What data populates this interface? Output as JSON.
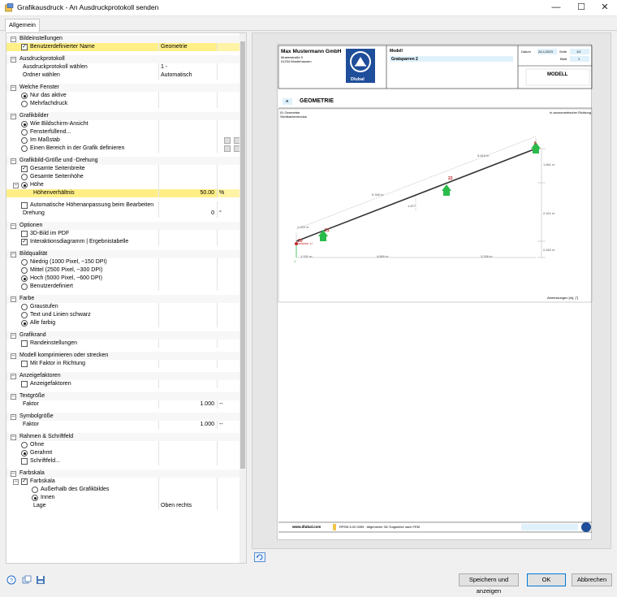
{
  "window": {
    "title": "Grafikausdruck - An Ausdruckprotokoll senden",
    "minimize": "—",
    "maximize": "☐",
    "close": "✕"
  },
  "tabs": [
    "Allgemein"
  ],
  "colors": {
    "selection": "#ffef86",
    "dlubal_blue": "#1f4e9a",
    "accent_blue": "#0078d7",
    "support_green": "#2bbb4a",
    "node_red": "#c0282d"
  },
  "rows": [
    {
      "kind": "hdr",
      "label": "Bildeinstellungen",
      "expanded": true
    },
    {
      "kind": "chk",
      "level": 1,
      "label": "Benutzerdefinierter Name",
      "checked": true,
      "value": "Geometrie",
      "selected": true
    },
    {
      "kind": "gap"
    },
    {
      "kind": "hdr",
      "label": "Ausdruckprotokoll",
      "expanded": true
    },
    {
      "kind": "txt",
      "level": 1,
      "label": "Ausdruckprotokoll wählen",
      "value": "1 -"
    },
    {
      "kind": "txt",
      "level": 1,
      "label": "Ordner wählen",
      "value": "Automatisch"
    },
    {
      "kind": "gap"
    },
    {
      "kind": "hdr",
      "label": "Welche Fenster",
      "expanded": true
    },
    {
      "kind": "rad",
      "level": 1,
      "label": "Nur das aktive",
      "checked": true
    },
    {
      "kind": "rad",
      "level": 1,
      "label": "Mehrfachdruck",
      "checked": false
    },
    {
      "kind": "gap"
    },
    {
      "kind": "hdr",
      "label": "Grafikbilder",
      "expanded": true
    },
    {
      "kind": "rad",
      "level": 1,
      "label": "Wie Bildschirm-Ansicht",
      "checked": true
    },
    {
      "kind": "rad",
      "level": 1,
      "label": "Fensterfüllend...",
      "checked": false
    },
    {
      "kind": "rad",
      "level": 1,
      "label": "Im Maßstab",
      "checked": false,
      "icons": true
    },
    {
      "kind": "rad",
      "level": 1,
      "label": "Einen Bereich in der Grafik definieren",
      "checked": false,
      "icons": true
    },
    {
      "kind": "gap"
    },
    {
      "kind": "hdr",
      "label": "Grafikbild-Größe und -Drehung",
      "expanded": true
    },
    {
      "kind": "chk",
      "level": 1,
      "label": "Gesamte Seitenbreite",
      "checked": true
    },
    {
      "kind": "rad",
      "level": 1,
      "label": "Gesamte Seitenhöhe",
      "checked": false
    },
    {
      "kind": "rad",
      "level": 1,
      "label": "Höhe",
      "checked": true,
      "expander": true
    },
    {
      "kind": "txt",
      "level": 2,
      "label": "Höhenverhältnis",
      "value": "50.00",
      "unit": "%",
      "selected": true,
      "numeric": true
    },
    {
      "kind": "gap"
    },
    {
      "kind": "chk",
      "level": 1,
      "label": "Automatische Höhenanpassung beim Bearbeiten",
      "checked": false
    },
    {
      "kind": "txt",
      "level": 1,
      "label": "Drehung",
      "value": "0",
      "unit": "°",
      "numeric": true
    },
    {
      "kind": "gap"
    },
    {
      "kind": "hdr",
      "label": "Optionen",
      "expanded": true
    },
    {
      "kind": "chk",
      "level": 1,
      "label": "3D-Bild im PDF",
      "checked": false
    },
    {
      "kind": "chk",
      "level": 1,
      "label": "Interaktionsdiagramm | Ergebnistabelle",
      "checked": true
    },
    {
      "kind": "gap"
    },
    {
      "kind": "hdr",
      "label": "Bildqualität",
      "expanded": true
    },
    {
      "kind": "rad",
      "level": 1,
      "label": "Niedrig (1000 Pixel, ~150 DPI)",
      "checked": false
    },
    {
      "kind": "rad",
      "level": 1,
      "label": "Mittel (2500 Pixel, ~300 DPI)",
      "checked": false
    },
    {
      "kind": "rad",
      "level": 1,
      "label": "Hoch (5000 Pixel, ~600 DPI)",
      "checked": true
    },
    {
      "kind": "rad",
      "level": 1,
      "label": "Benutzerdefiniert",
      "checked": false
    },
    {
      "kind": "gap"
    },
    {
      "kind": "hdr",
      "label": "Farbe",
      "expanded": true
    },
    {
      "kind": "rad",
      "level": 1,
      "label": "Graustufen",
      "checked": false
    },
    {
      "kind": "rad",
      "level": 1,
      "label": "Text und Linien schwarz",
      "checked": false
    },
    {
      "kind": "rad",
      "level": 1,
      "label": "Alle farbig",
      "checked": true
    },
    {
      "kind": "gap"
    },
    {
      "kind": "hdr",
      "label": "Grafikrand",
      "expanded": true
    },
    {
      "kind": "chk",
      "level": 1,
      "label": "Randeinstellungen",
      "checked": false
    },
    {
      "kind": "gap"
    },
    {
      "kind": "hdr",
      "label": "Modell komprimieren oder strecken",
      "expanded": true
    },
    {
      "kind": "chk",
      "level": 1,
      "label": "Mit Faktor in Richtung",
      "checked": false
    },
    {
      "kind": "gap"
    },
    {
      "kind": "hdr",
      "label": "Anzeigefaktoren",
      "expanded": true
    },
    {
      "kind": "chk",
      "level": 1,
      "label": "Anzeigefaktoren",
      "checked": false
    },
    {
      "kind": "gap"
    },
    {
      "kind": "hdr",
      "label": "Textgröße",
      "expanded": true
    },
    {
      "kind": "txt",
      "level": 1,
      "label": "Faktor",
      "value": "1.000",
      "unit": "--",
      "numeric": true
    },
    {
      "kind": "gap"
    },
    {
      "kind": "hdr",
      "label": "Symbolgröße",
      "expanded": true
    },
    {
      "kind": "txt",
      "level": 1,
      "label": "Faktor",
      "value": "1.000",
      "unit": "--",
      "numeric": true
    },
    {
      "kind": "gap"
    },
    {
      "kind": "hdr",
      "label": "Rahmen & Schriftfeld",
      "expanded": true
    },
    {
      "kind": "rad",
      "level": 1,
      "label": "Ohne",
      "checked": false
    },
    {
      "kind": "rad",
      "level": 1,
      "label": "Gerahmt",
      "checked": true
    },
    {
      "kind": "chk",
      "level": 1,
      "label": "Schriftfeld...",
      "checked": false
    },
    {
      "kind": "gap"
    },
    {
      "kind": "hdr",
      "label": "Farbskala",
      "expanded": true
    },
    {
      "kind": "chk",
      "level": 1,
      "label": "Farbskala",
      "checked": true,
      "expander": true
    },
    {
      "kind": "rad",
      "level": 2,
      "label": "Außerhalb des Grafikbildes",
      "checked": false
    },
    {
      "kind": "rad",
      "level": 2,
      "label": "Innen",
      "checked": true
    },
    {
      "kind": "txt",
      "level": 2,
      "label": "Lage",
      "value": "Oben rechts"
    }
  ],
  "preview": {
    "company": "Max Mustermann GmbH",
    "street": "Musterstraße 5",
    "city": "01234 Musterhausen",
    "logo": "Dlubal",
    "model_label": "Modell",
    "model_value": "Gratsparren 2",
    "date_label": "Datum",
    "date_value": "24.4.2023",
    "page_label": "Seite",
    "page_value": "1/1",
    "sheet_label": "Blatt",
    "sheet_value": "1",
    "section": "MODELL",
    "chapter_tag": "A",
    "chapter": "GEOMETRIE",
    "fig_line1": "01 Geometrie",
    "fig_line2": "Sichtkantenmodus",
    "direction": "In axonometrischer Richtung",
    "units": "Abmessungen [m], [°]",
    "nodes": [
      "6",
      "22",
      "21",
      "20"
    ],
    "dims_top": [
      "5.818 m",
      "5.346 m",
      "1.222 m"
    ],
    "dims_bottom": [
      "1.151 m",
      "4.860 m",
      "3.338 m"
    ],
    "dims_right": [
      "1.661 m",
      "2.421 m",
      "0.482 m"
    ],
    "dim_mid": "1.877",
    "axis_u": "U",
    "axis_v": "V",
    "footer_web": "www.dlubal.com",
    "footer_prog": "RFEM 6.02.0059 · Allgemeine 3D-Tragwerke nach FEM"
  },
  "buttons": {
    "apply": "Speichern und anzeigen",
    "ok": "OK",
    "cancel": "Abbrechen"
  },
  "icons": [
    "help-icon",
    "copy-settings-icon",
    "save-settings-icon",
    "refresh-preview-icon"
  ]
}
